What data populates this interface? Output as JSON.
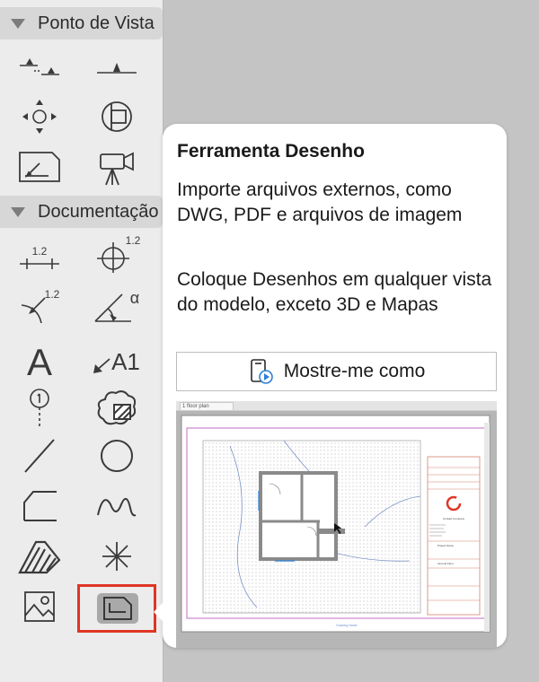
{
  "toolbox": {
    "sections": [
      {
        "label": "Ponto de Vista"
      },
      {
        "label": "Documentação"
      }
    ],
    "dimension_labels": {
      "linear": "1.2",
      "radial": "1.2",
      "angle_symbol": "α",
      "level_dimension": "1.2",
      "label_tool": "A1",
      "text_tool": "A"
    }
  },
  "tooltip": {
    "title": "Ferramenta Desenho",
    "paragraph1": "Importe arquivos externos, como DWG, PDF e arquivos de imagem",
    "paragraph2": "Coloque Desenhos em qualquer vista do modelo, exceto 3D e Mapas",
    "show_me_label": "Mostre-me como",
    "preview": {
      "tab_label": "1 floor plan",
      "stamp_company": "Contact Company",
      "stamp_project": "Project Name",
      "stamp_drawing": "Ground Floor",
      "bottom_label": "Drawing Name"
    }
  },
  "colors": {
    "selection_border": "#e03525",
    "icon_stroke": "#3a3a3a",
    "accent_blue": "#2f7fd8"
  }
}
